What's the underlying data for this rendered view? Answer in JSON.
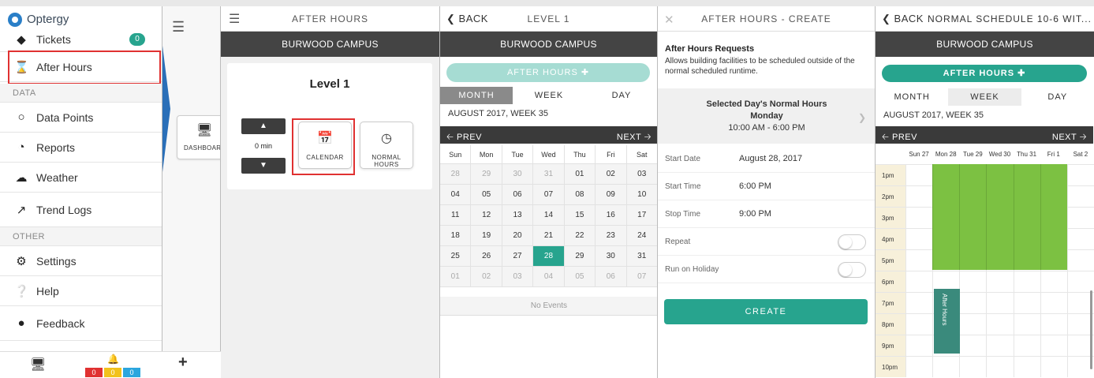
{
  "sidebar": {
    "logo": "Optergy",
    "items": [
      {
        "label": "Tickets",
        "icon": "ticket-icon",
        "badge": "0"
      },
      {
        "label": "After Hours",
        "icon": "hourglass-icon"
      },
      {
        "label": "Data Points",
        "icon": "circle-icon"
      },
      {
        "label": "Reports",
        "icon": "pie-chart-icon"
      },
      {
        "label": "Weather",
        "icon": "cloud-icon"
      },
      {
        "label": "Trend Logs",
        "icon": "line-chart-icon"
      },
      {
        "label": "Settings",
        "icon": "gears-icon"
      },
      {
        "label": "Help",
        "icon": "question-icon"
      },
      {
        "label": "Feedback",
        "icon": "speech-bubble-icon"
      }
    ],
    "section_data": "DATA",
    "section_other": "OTHER"
  },
  "footer": {
    "alarm_counts": [
      "0",
      "0",
      "0"
    ],
    "alarm_colors": [
      "#e03131",
      "#f2c21b",
      "#2ba6de"
    ]
  },
  "panel2": {
    "dashboard_label": "DASHBOARD"
  },
  "panel3": {
    "header": "AFTER HOURS",
    "campus": "BURWOOD CAMPUS",
    "level_title": "Level 1",
    "stepper_value": "0 min",
    "calendar_label": "CALENDAR",
    "normal_hours_label": "NORMAL HOURS"
  },
  "panel4": {
    "back": "BACK",
    "header": "LEVEL 1",
    "campus": "BURWOOD CAMPUS",
    "after_hours_btn": "AFTER HOURS",
    "tabs": [
      "MONTH",
      "WEEK",
      "DAY"
    ],
    "week_label": "AUGUST 2017, WEEK 35",
    "prev": "PREV",
    "next": "NEXT",
    "weekdays": [
      "Sun",
      "Mon",
      "Tue",
      "Wed",
      "Thu",
      "Fri",
      "Sat"
    ],
    "weeks": [
      [
        "28",
        "29",
        "30",
        "31",
        "01",
        "02",
        "03"
      ],
      [
        "04",
        "05",
        "06",
        "07",
        "08",
        "09",
        "10"
      ],
      [
        "11",
        "12",
        "13",
        "14",
        "15",
        "16",
        "17"
      ],
      [
        "18",
        "19",
        "20",
        "21",
        "22",
        "23",
        "24"
      ],
      [
        "25",
        "26",
        "27",
        "28",
        "29",
        "30",
        "31"
      ],
      [
        "01",
        "02",
        "03",
        "04",
        "05",
        "06",
        "07"
      ]
    ],
    "no_events": "No Events"
  },
  "panel5": {
    "header": "AFTER HOURS - CREATE",
    "section_title": "After Hours Requests",
    "section_desc": "Allows building facilities to be scheduled outside of the normal scheduled runtime.",
    "normal_title": "Selected Day's Normal Hours",
    "normal_day": "Monday",
    "normal_range": "10:00 AM - 6:00 PM",
    "start_date_label": "Start Date",
    "start_date_value": "August 28, 2017",
    "start_time_label": "Start Time",
    "start_time_value": "6:00 PM",
    "stop_time_label": "Stop Time",
    "stop_time_value": "9:00 PM",
    "repeat_label": "Repeat",
    "holiday_label": "Run on Holiday",
    "create_btn": "CREATE"
  },
  "panel6": {
    "back": "BACK",
    "header": "NORMAL SCHEDULE 10-6 WIT...",
    "campus": "BURWOOD CAMPUS",
    "after_hours_btn": "AFTER HOURS",
    "tabs": [
      "MONTH",
      "WEEK",
      "DAY"
    ],
    "week_label": "AUGUST 2017, WEEK 35",
    "prev": "PREV",
    "next": "NEXT",
    "days": [
      "Sun 27",
      "Mon 28",
      "Tue 29",
      "Wed 30",
      "Thu 31",
      "Fri 1",
      "Sat 2"
    ],
    "hours": [
      "1pm",
      "2pm",
      "3pm",
      "4pm",
      "5pm",
      "6pm",
      "7pm",
      "8pm",
      "9pm",
      "10pm"
    ],
    "event_label": "After Hours"
  }
}
